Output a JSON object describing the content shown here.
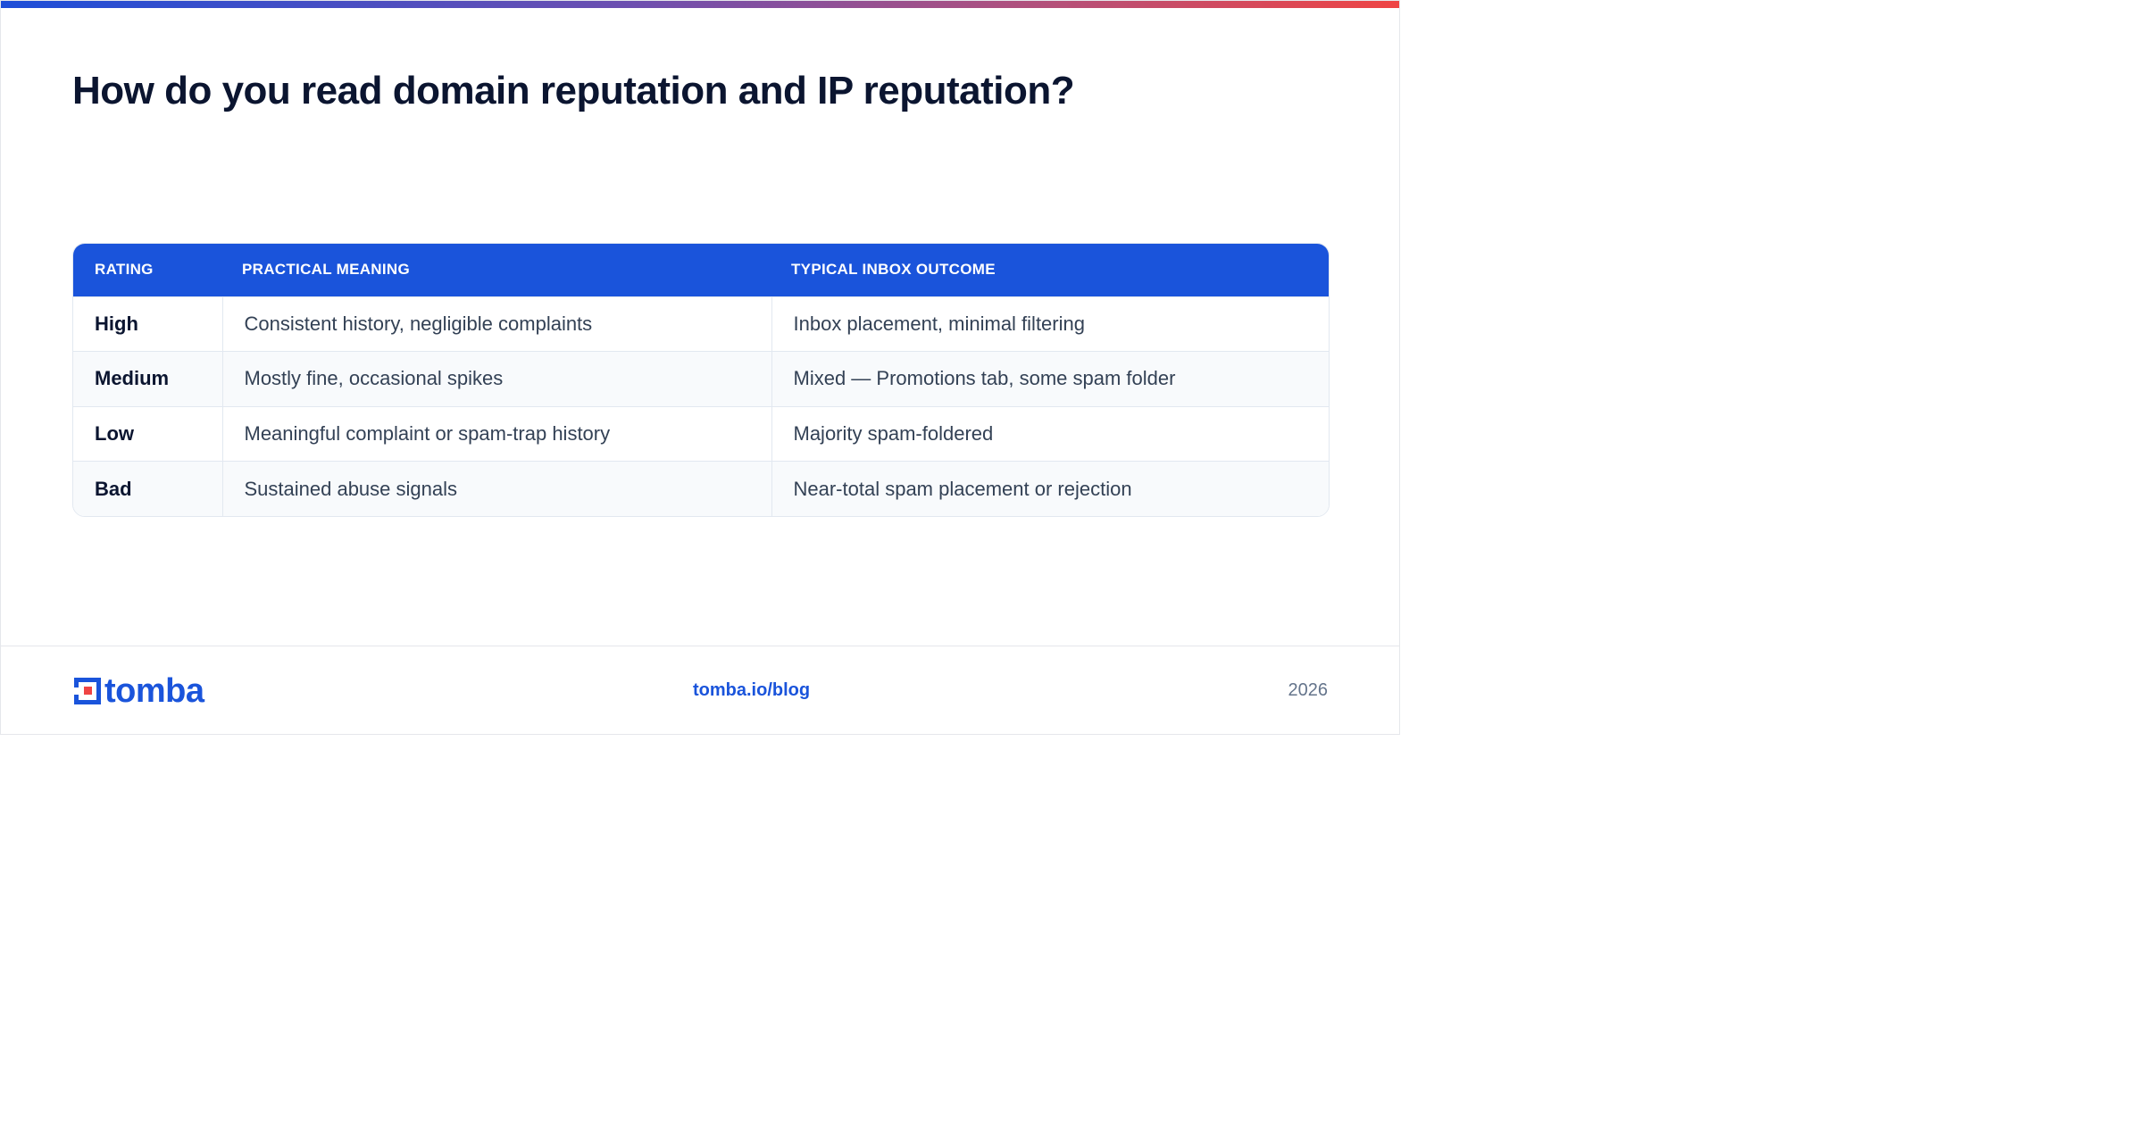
{
  "header": {
    "title": "How do you read domain reputation and IP reputation?"
  },
  "table": {
    "columns": [
      "RATING",
      "PRACTICAL MEANING",
      "TYPICAL INBOX OUTCOME"
    ],
    "rows": [
      {
        "rating": "High",
        "meaning": "Consistent history, negligible complaints",
        "outcome": "Inbox placement, minimal filtering"
      },
      {
        "rating": "Medium",
        "meaning": "Mostly fine, occasional spikes",
        "outcome": "Mixed — Promotions tab, some spam folder"
      },
      {
        "rating": "Low",
        "meaning": "Meaningful complaint or spam-trap history",
        "outcome": "Majority spam-foldered"
      },
      {
        "rating": "Bad",
        "meaning": "Sustained abuse signals",
        "outcome": "Near-total spam placement or rejection"
      }
    ]
  },
  "footer": {
    "logo_text": "tomba",
    "link": "tomba.io/blog",
    "year": "2026"
  },
  "colors": {
    "brand_blue": "#1a54db",
    "accent_red": "#ef4444"
  }
}
